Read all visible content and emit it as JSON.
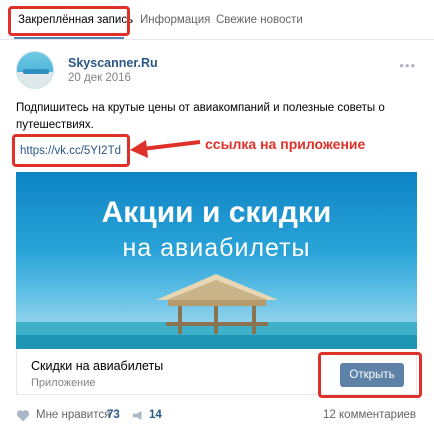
{
  "tabs": [
    {
      "label": "Закреплённая запись",
      "active": true
    },
    {
      "label": "Информация",
      "active": false
    },
    {
      "label": "Свежие новости",
      "active": false
    }
  ],
  "post": {
    "author": "Skyscanner.Ru",
    "date": "20 дек 2016",
    "text": "Подпишитесь на крутые цены от авиакомпаний и полезные советы о путешествиях.",
    "link": "https://vk.cc/5YI2Td"
  },
  "annotation": "ссылка на приложение",
  "banner": {
    "title": "Акции и скидки",
    "subtitle": "на авиабилеты"
  },
  "card": {
    "title": "Скидки на авиабилеты",
    "subtitle": "Приложение",
    "button_label": "Открыть"
  },
  "footer": {
    "like_label": "Мне нравится",
    "like_count": "73",
    "share_count": "14",
    "comments_label": "12 комментариев"
  },
  "colors": {
    "accent": "#5181b8",
    "link": "#2a5885",
    "highlight": "#e0302a",
    "button": "#5e81a8"
  }
}
